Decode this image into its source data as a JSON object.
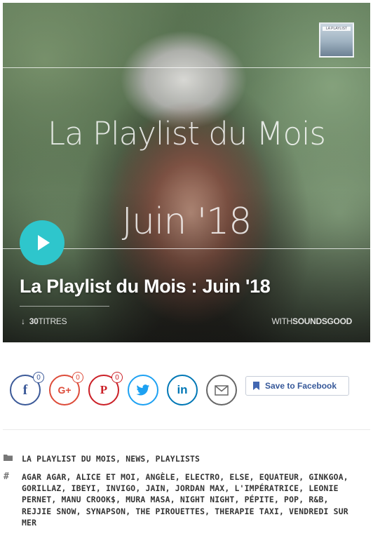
{
  "player": {
    "cover_line1": "La Playlist du Mois",
    "cover_line2": "Juin '18",
    "thumb_label": "LA PLAYLIST",
    "title": "La Playlist du Mois : Juin '18",
    "tracks_count": "30",
    "tracks_label": "TITRES",
    "with_prefix": "WITH",
    "with_brand": "SOUNDSGOOD",
    "accent_color": "#2ec6cc"
  },
  "share": {
    "facebook": {
      "glyph": "f",
      "count": "0",
      "icon": "facebook-icon"
    },
    "googleplus": {
      "glyph": "G+",
      "count": "0",
      "icon": "google-plus-icon"
    },
    "pinterest": {
      "glyph": "P",
      "count": "0",
      "icon": "pinterest-icon"
    },
    "twitter": {
      "icon": "twitter-icon"
    },
    "linkedin": {
      "glyph": "in",
      "icon": "linkedin-icon"
    },
    "mail": {
      "icon": "mail-icon"
    },
    "save_label": "Save to Facebook"
  },
  "meta": {
    "categories": [
      "LA PLAYLIST DU MOIS",
      "NEWS",
      "PLAYLISTS"
    ],
    "tags_text": "AGAR AGAR, ALICE ET MOI, ANGÈLE, ELECTRO, ELSE, EQUATEUR, GINKGOA, GORILLAZ, IBEYI, INVIGO, JAIN, JORDAN MAX, L'IMPÉRATRICE, LEONIE PERNET, MANU CROOK$, MURA MASA, NIGHT NIGHT, PÉPITE, POP, R&B, REJJIE SNOW, SYNAPSON, THE PIROUETTES, THERAPIE TAXI, VENDREDI SUR MER"
  }
}
